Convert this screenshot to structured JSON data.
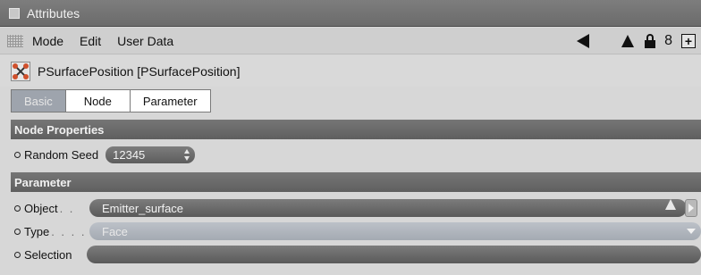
{
  "window": {
    "title": "Attributes"
  },
  "menu": {
    "items": [
      "Mode",
      "Edit",
      "User Data"
    ],
    "icons": [
      "back-arrow-icon",
      "up-arrow-icon",
      "lock-icon",
      "link-8-icon",
      "add-panel-icon"
    ]
  },
  "object": {
    "name": "PSurfacePosition [PSurfacePosition]",
    "icon": "node-icon"
  },
  "tabs": [
    {
      "label": "Basic",
      "active": true
    },
    {
      "label": "Node",
      "active": false
    },
    {
      "label": "Parameter",
      "active": false
    }
  ],
  "sections": {
    "node_properties": {
      "title": "Node Properties",
      "random_seed": {
        "label": "Random Seed",
        "value": "12345"
      }
    },
    "parameter": {
      "title": "Parameter",
      "object": {
        "label": "Object",
        "dots": ". .",
        "value": "Emitter_surface"
      },
      "type": {
        "label": "Type",
        "dots": ". . . .",
        "value": "Face"
      },
      "selection": {
        "label": "Selection",
        "value": ""
      }
    }
  },
  "colors": {
    "title_bar": "#6f6f6f",
    "section_header": "#666666",
    "field_dark": "#6a6a6a",
    "tab_active": "#9ea4ad"
  }
}
